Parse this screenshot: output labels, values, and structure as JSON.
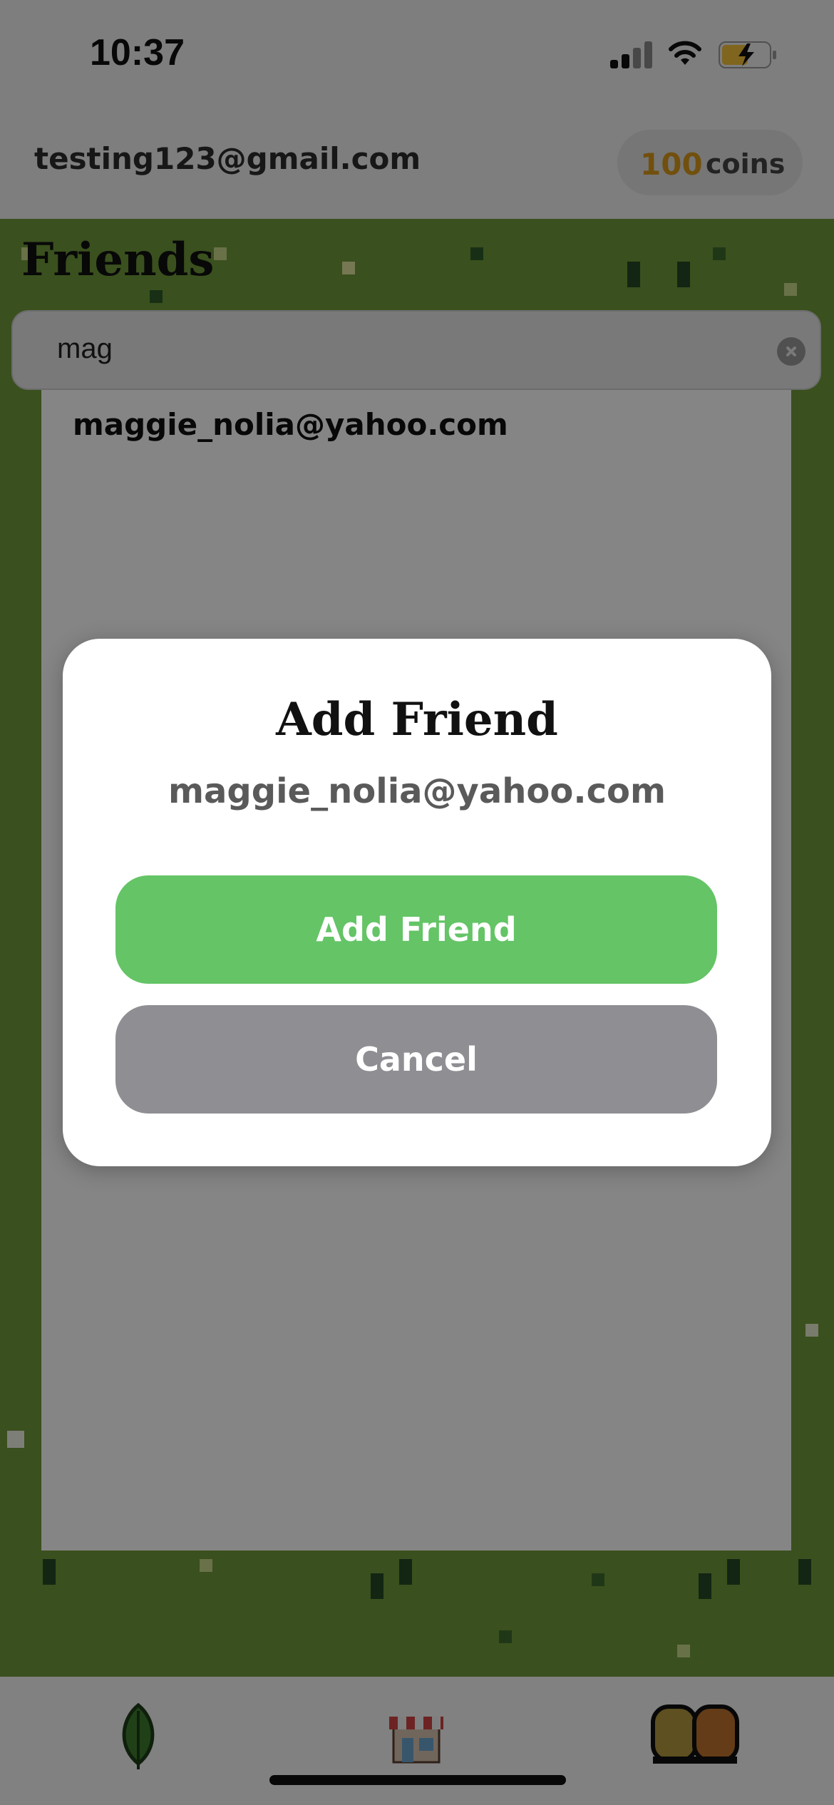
{
  "status_bar": {
    "time": "10:37"
  },
  "header": {
    "user_email": "testing123@gmail.com",
    "coins_value": "100",
    "coins_label": "coins",
    "coin_color": "#d99a1b"
  },
  "page": {
    "title": "Friends"
  },
  "search": {
    "value": "mag"
  },
  "results": [
    "maggie_nolia@yahoo.com"
  ],
  "dialog": {
    "title": "Add Friend",
    "email": "maggie_nolia@yahoo.com",
    "confirm_label": "Add Friend",
    "cancel_label": "Cancel",
    "confirm_color": "#64c466",
    "cancel_color": "#8e8e93"
  },
  "tab_bar": {
    "tabs": [
      {
        "icon": "leaf-icon"
      },
      {
        "icon": "shop-icon"
      },
      {
        "icon": "friends-icon"
      }
    ]
  }
}
